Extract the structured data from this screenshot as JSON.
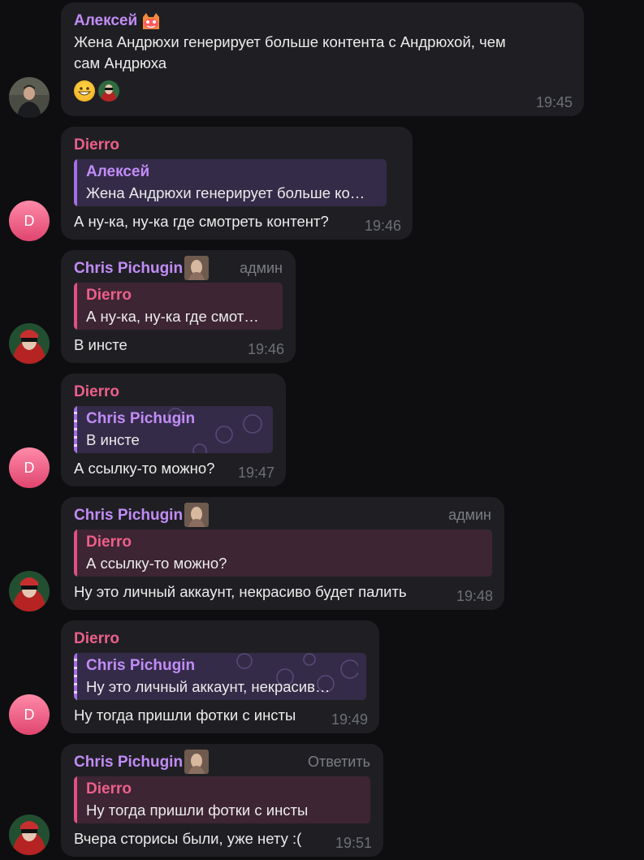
{
  "messages": [
    {
      "sender": "Алексей",
      "text_lines": [
        "Жена Андрюхи генерирует больше контента с Андрюхой, чем",
        "сам Андрюха"
      ],
      "time": "19:45",
      "reactions": [
        "grinning-face-emoji",
        "user-avatar-reaction"
      ]
    },
    {
      "sender": "Dierro",
      "avatar_letter": "D",
      "quote": {
        "name": "Алексей",
        "text": "Жена Андрюхи генерирует больше ко…"
      },
      "text": "А ну-ка, ну-ка где смотреть контент?",
      "time": "19:46"
    },
    {
      "sender": "Chris Pichugin",
      "role": "админ",
      "quote": {
        "name": "Dierro",
        "text": "А ну-ка, ну-ка где смот…"
      },
      "text": "В инсте",
      "time": "19:46"
    },
    {
      "sender": "Dierro",
      "avatar_letter": "D",
      "quote": {
        "name": "Chris Pichugin",
        "text": "В инсте"
      },
      "text": "А ссылку-то можно?",
      "time": "19:47"
    },
    {
      "sender": "Chris Pichugin",
      "role": "админ",
      "quote": {
        "name": "Dierro",
        "text": "А ссылку-то можно?"
      },
      "text": "Ну это личный аккаунт, некрасиво будет палить",
      "time": "19:48"
    },
    {
      "sender": "Dierro",
      "avatar_letter": "D",
      "quote": {
        "name": "Chris Pichugin",
        "text": "Ну это личный аккаунт, некрасив…"
      },
      "text": "Ну тогда пришли фотки с инсты",
      "time": "19:49"
    },
    {
      "sender": "Chris Pichugin",
      "role": "Ответить",
      "quote": {
        "name": "Dierro",
        "text": "Ну тогда пришли фотки с инсты"
      },
      "text": "Вчера сторисы были, уже нету :(",
      "time": "19:51"
    }
  ],
  "colors": {
    "background": "#0e0e10",
    "bubble": "#1f1f23",
    "name_purple": "#c18cf7",
    "name_pink": "#ed5f8a",
    "time": "#6c6f76"
  }
}
